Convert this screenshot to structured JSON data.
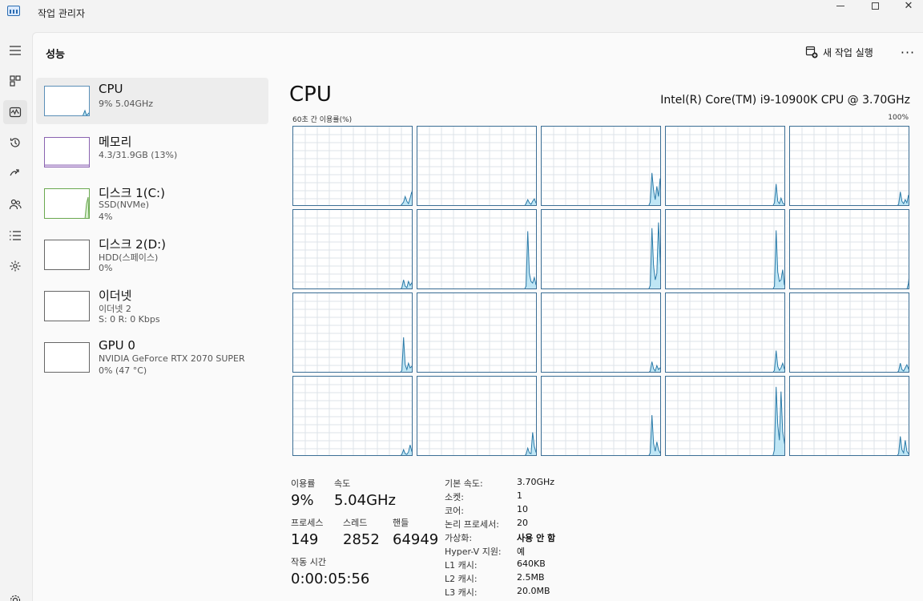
{
  "window": {
    "title": "작업 관리자",
    "min_icon": "minimize-icon",
    "max_icon": "maximize-icon",
    "close_glyph": "✕"
  },
  "nav": [
    {
      "icon": "hamburger-icon",
      "active": false
    },
    {
      "icon": "processes-icon",
      "active": false
    },
    {
      "icon": "performance-icon",
      "active": true
    },
    {
      "icon": "app-history-icon",
      "active": false
    },
    {
      "icon": "startup-apps-icon",
      "active": false
    },
    {
      "icon": "users-icon",
      "active": false
    },
    {
      "icon": "details-icon",
      "active": false
    },
    {
      "icon": "services-icon",
      "active": false
    },
    {
      "icon": "settings-icon",
      "active": false
    }
  ],
  "header": {
    "title": "성능",
    "run_task": "새 작업 실행",
    "more": "···"
  },
  "sidebar": [
    {
      "name": "CPU",
      "lines": [
        "9% 5.04GHz"
      ]
    },
    {
      "name": "메모리",
      "lines": [
        "4.3/31.9GB (13%)"
      ]
    },
    {
      "name": "디스크 1(C:)",
      "lines": [
        "SSD(NVMe)",
        "4%"
      ]
    },
    {
      "name": "디스크 2(D:)",
      "lines": [
        "HDD(스페이스)",
        "0%"
      ]
    },
    {
      "name": "이더넷",
      "lines": [
        "이더넷 2",
        "S: 0 R: 0 Kbps"
      ]
    },
    {
      "name": "GPU 0",
      "lines": [
        "NVIDIA GeForce RTX 2070 SUPER",
        "0% (47 °C)"
      ]
    }
  ],
  "cpu": {
    "title": "CPU",
    "model": "Intel(R) Core(TM) i9-10900K CPU @ 3.70GHz",
    "graph_label": "60초 간 이용률(%)",
    "graph_max": "100%",
    "colors": {
      "line": "#2a7aa8",
      "fill": "#bfe6f5",
      "grid": "#dde3e8",
      "border": "#3b6e95"
    },
    "cores": [
      [
        0,
        0,
        0,
        0,
        0,
        0,
        0,
        0,
        0,
        0,
        0,
        0,
        0,
        0,
        0,
        0,
        0,
        0,
        0,
        0,
        0,
        0,
        0,
        0,
        0,
        0,
        0,
        0,
        0,
        0,
        0,
        0,
        0,
        0,
        0,
        0,
        0,
        0,
        0,
        0,
        0,
        0,
        0,
        0,
        0,
        0,
        0,
        0,
        0,
        0,
        0,
        0,
        0,
        0,
        0,
        0,
        0,
        0,
        0,
        0,
        0,
        0,
        0,
        0,
        0,
        0,
        2,
        5,
        12,
        6,
        3,
        10,
        18,
        8
      ],
      [
        0,
        0,
        0,
        0,
        0,
        0,
        0,
        0,
        0,
        0,
        0,
        0,
        0,
        0,
        0,
        0,
        0,
        0,
        0,
        0,
        0,
        0,
        0,
        0,
        0,
        0,
        0,
        0,
        0,
        0,
        0,
        0,
        0,
        0,
        0,
        0,
        0,
        0,
        0,
        0,
        0,
        0,
        0,
        0,
        0,
        0,
        0,
        0,
        0,
        0,
        0,
        0,
        0,
        0,
        0,
        0,
        0,
        0,
        0,
        0,
        0,
        0,
        0,
        0,
        0,
        0,
        3,
        8,
        4,
        2,
        6,
        9,
        4,
        2
      ],
      [
        0,
        0,
        0,
        0,
        0,
        0,
        0,
        0,
        0,
        0,
        0,
        0,
        0,
        0,
        0,
        0,
        0,
        0,
        0,
        0,
        0,
        0,
        0,
        0,
        0,
        0,
        0,
        0,
        0,
        0,
        0,
        0,
        0,
        0,
        0,
        0,
        0,
        0,
        0,
        0,
        0,
        0,
        0,
        0,
        0,
        0,
        0,
        0,
        0,
        0,
        0,
        0,
        0,
        0,
        0,
        0,
        0,
        0,
        0,
        0,
        0,
        0,
        0,
        0,
        0,
        0,
        5,
        42,
        20,
        8,
        25,
        12,
        35,
        6
      ],
      [
        0,
        0,
        0,
        0,
        0,
        0,
        0,
        0,
        0,
        0,
        0,
        0,
        0,
        0,
        0,
        0,
        0,
        0,
        0,
        0,
        0,
        0,
        0,
        0,
        0,
        0,
        0,
        0,
        0,
        0,
        0,
        0,
        0,
        0,
        0,
        0,
        0,
        0,
        0,
        0,
        0,
        0,
        0,
        0,
        0,
        0,
        0,
        0,
        0,
        0,
        0,
        0,
        0,
        0,
        0,
        0,
        0,
        0,
        0,
        0,
        0,
        0,
        0,
        0,
        0,
        0,
        4,
        28,
        6,
        3,
        10,
        4,
        2,
        1
      ],
      [
        0,
        0,
        0,
        0,
        0,
        0,
        0,
        0,
        0,
        0,
        0,
        0,
        0,
        0,
        0,
        0,
        0,
        0,
        0,
        0,
        0,
        0,
        0,
        0,
        0,
        0,
        0,
        0,
        0,
        0,
        0,
        0,
        0,
        0,
        0,
        0,
        0,
        0,
        0,
        0,
        0,
        0,
        0,
        0,
        0,
        0,
        0,
        0,
        0,
        0,
        0,
        0,
        0,
        0,
        0,
        0,
        0,
        0,
        0,
        0,
        0,
        0,
        0,
        0,
        0,
        0,
        2,
        18,
        6,
        3,
        8,
        4,
        14,
        5
      ],
      [
        0,
        0,
        0,
        0,
        0,
        0,
        0,
        0,
        0,
        0,
        0,
        0,
        0,
        0,
        0,
        0,
        0,
        0,
        0,
        0,
        0,
        0,
        0,
        0,
        0,
        0,
        0,
        0,
        0,
        0,
        0,
        0,
        0,
        0,
        0,
        0,
        0,
        0,
        0,
        0,
        0,
        0,
        0,
        0,
        0,
        0,
        0,
        0,
        0,
        0,
        0,
        0,
        0,
        0,
        0,
        0,
        0,
        0,
        0,
        0,
        0,
        0,
        0,
        0,
        0,
        0,
        2,
        12,
        4,
        2,
        10,
        5,
        8,
        3
      ],
      [
        0,
        0,
        0,
        0,
        0,
        0,
        0,
        0,
        0,
        0,
        0,
        0,
        0,
        0,
        0,
        0,
        0,
        0,
        0,
        0,
        0,
        0,
        0,
        0,
        0,
        0,
        0,
        0,
        0,
        0,
        0,
        0,
        0,
        0,
        0,
        0,
        0,
        0,
        0,
        0,
        0,
        0,
        0,
        0,
        0,
        0,
        0,
        0,
        0,
        0,
        0,
        0,
        0,
        0,
        0,
        0,
        0,
        0,
        0,
        0,
        0,
        0,
        0,
        0,
        0,
        0,
        4,
        74,
        20,
        10,
        8,
        15,
        6,
        3
      ],
      [
        0,
        0,
        0,
        0,
        0,
        0,
        0,
        0,
        0,
        0,
        0,
        0,
        0,
        0,
        0,
        0,
        0,
        0,
        0,
        0,
        0,
        0,
        0,
        0,
        0,
        0,
        0,
        0,
        0,
        0,
        0,
        0,
        0,
        0,
        0,
        0,
        0,
        0,
        0,
        0,
        0,
        0,
        0,
        0,
        0,
        0,
        0,
        0,
        0,
        0,
        0,
        0,
        0,
        0,
        0,
        0,
        0,
        0,
        0,
        0,
        0,
        0,
        0,
        0,
        0,
        0,
        5,
        78,
        30,
        12,
        20,
        85,
        40,
        10
      ],
      [
        0,
        0,
        0,
        0,
        0,
        0,
        0,
        0,
        0,
        0,
        0,
        0,
        0,
        0,
        0,
        0,
        0,
        0,
        0,
        0,
        0,
        0,
        0,
        0,
        0,
        0,
        0,
        0,
        0,
        0,
        0,
        0,
        0,
        0,
        0,
        0,
        0,
        0,
        0,
        0,
        0,
        0,
        0,
        0,
        0,
        0,
        0,
        0,
        0,
        0,
        0,
        0,
        0,
        0,
        0,
        0,
        0,
        0,
        0,
        0,
        0,
        0,
        0,
        0,
        0,
        0,
        4,
        75,
        22,
        10,
        12,
        25,
        6,
        3
      ],
      [
        0,
        0,
        0,
        0,
        0,
        0,
        0,
        0,
        0,
        0,
        0,
        0,
        0,
        0,
        0,
        0,
        0,
        0,
        0,
        0,
        0,
        0,
        0,
        0,
        0,
        0,
        0,
        0,
        0,
        0,
        0,
        0,
        0,
        0,
        0,
        0,
        0,
        0,
        0,
        0,
        0,
        0,
        0,
        0,
        0,
        0,
        0,
        0,
        0,
        0,
        0,
        0,
        0,
        0,
        0,
        0,
        0,
        0,
        0,
        0,
        0,
        0,
        0,
        0,
        0,
        0,
        0,
        0,
        0,
        0,
        0,
        0,
        8,
        30
      ],
      [
        0,
        0,
        0,
        0,
        0,
        0,
        0,
        0,
        0,
        0,
        0,
        0,
        0,
        0,
        0,
        0,
        0,
        0,
        0,
        0,
        0,
        0,
        0,
        0,
        0,
        0,
        0,
        0,
        0,
        0,
        0,
        0,
        0,
        0,
        0,
        0,
        0,
        0,
        0,
        0,
        0,
        0,
        0,
        0,
        0,
        0,
        0,
        0,
        0,
        0,
        0,
        0,
        0,
        0,
        0,
        0,
        0,
        0,
        0,
        0,
        0,
        0,
        0,
        0,
        0,
        0,
        3,
        45,
        10,
        4,
        12,
        6,
        8,
        3
      ],
      [
        0,
        0,
        0,
        0,
        0,
        0,
        0,
        0,
        0,
        0,
        0,
        0,
        0,
        0,
        0,
        0,
        0,
        0,
        0,
        0,
        0,
        0,
        0,
        0,
        0,
        0,
        0,
        0,
        0,
        0,
        0,
        0,
        0,
        0,
        0,
        0,
        0,
        0,
        0,
        0,
        0,
        0,
        0,
        0,
        0,
        0,
        0,
        0,
        0,
        0,
        0,
        0,
        0,
        0,
        0,
        0,
        0,
        0,
        0,
        0,
        0,
        0,
        0,
        0,
        0,
        0,
        0,
        0,
        0,
        0,
        0,
        0,
        0,
        0
      ],
      [
        0,
        0,
        0,
        0,
        0,
        0,
        0,
        0,
        0,
        0,
        0,
        0,
        0,
        0,
        0,
        0,
        0,
        0,
        0,
        0,
        0,
        0,
        0,
        0,
        0,
        0,
        0,
        0,
        0,
        0,
        0,
        0,
        0,
        0,
        0,
        0,
        0,
        0,
        0,
        0,
        0,
        0,
        0,
        0,
        0,
        0,
        0,
        0,
        0,
        0,
        0,
        0,
        0,
        0,
        0,
        0,
        0,
        0,
        0,
        0,
        0,
        0,
        0,
        0,
        0,
        0,
        2,
        14,
        5,
        2,
        9,
        4,
        6,
        2
      ],
      [
        0,
        0,
        0,
        0,
        0,
        0,
        0,
        0,
        0,
        0,
        0,
        0,
        0,
        0,
        0,
        0,
        0,
        0,
        0,
        0,
        0,
        0,
        0,
        0,
        0,
        0,
        0,
        0,
        0,
        0,
        0,
        0,
        0,
        0,
        0,
        0,
        0,
        0,
        0,
        0,
        0,
        0,
        0,
        0,
        0,
        0,
        0,
        0,
        0,
        0,
        0,
        0,
        0,
        0,
        0,
        0,
        0,
        0,
        0,
        0,
        0,
        0,
        0,
        0,
        0,
        0,
        3,
        28,
        8,
        3,
        6,
        12,
        5,
        2
      ],
      [
        0,
        0,
        0,
        0,
        0,
        0,
        0,
        0,
        0,
        0,
        0,
        0,
        0,
        0,
        0,
        0,
        0,
        0,
        0,
        0,
        0,
        0,
        0,
        0,
        0,
        0,
        0,
        0,
        0,
        0,
        0,
        0,
        0,
        0,
        0,
        0,
        0,
        0,
        0,
        0,
        0,
        0,
        0,
        0,
        0,
        0,
        0,
        0,
        0,
        0,
        0,
        0,
        0,
        0,
        0,
        0,
        0,
        0,
        0,
        0,
        0,
        0,
        0,
        0,
        0,
        0,
        2,
        12,
        4,
        2,
        6,
        10,
        5,
        2
      ],
      [
        0,
        0,
        0,
        0,
        0,
        0,
        0,
        0,
        0,
        0,
        0,
        0,
        0,
        0,
        0,
        0,
        0,
        0,
        0,
        0,
        0,
        0,
        0,
        0,
        0,
        0,
        0,
        0,
        0,
        0,
        0,
        0,
        0,
        0,
        0,
        0,
        0,
        0,
        0,
        0,
        0,
        0,
        0,
        0,
        0,
        0,
        0,
        0,
        0,
        0,
        0,
        0,
        0,
        0,
        0,
        0,
        0,
        0,
        0,
        0,
        0,
        0,
        0,
        0,
        0,
        0,
        2,
        8,
        3,
        2,
        5,
        14,
        6,
        3
      ],
      [
        0,
        0,
        0,
        0,
        0,
        0,
        0,
        0,
        0,
        0,
        0,
        0,
        0,
        0,
        0,
        0,
        0,
        0,
        0,
        0,
        0,
        0,
        0,
        0,
        0,
        0,
        0,
        0,
        0,
        0,
        0,
        0,
        0,
        0,
        0,
        0,
        0,
        0,
        0,
        0,
        0,
        0,
        0,
        0,
        0,
        0,
        0,
        0,
        0,
        0,
        0,
        0,
        0,
        0,
        0,
        0,
        0,
        0,
        0,
        0,
        0,
        0,
        0,
        0,
        0,
        0,
        2,
        10,
        4,
        3,
        30,
        12,
        5,
        2
      ],
      [
        0,
        0,
        0,
        0,
        0,
        0,
        0,
        0,
        0,
        0,
        0,
        0,
        0,
        0,
        0,
        0,
        0,
        0,
        0,
        0,
        0,
        0,
        0,
        0,
        0,
        0,
        0,
        0,
        0,
        0,
        0,
        0,
        0,
        0,
        0,
        0,
        0,
        0,
        0,
        0,
        0,
        0,
        0,
        0,
        0,
        0,
        0,
        0,
        0,
        0,
        0,
        0,
        0,
        0,
        0,
        0,
        0,
        0,
        0,
        0,
        0,
        0,
        0,
        0,
        0,
        0,
        4,
        52,
        16,
        6,
        18,
        8,
        4,
        2
      ],
      [
        0,
        0,
        0,
        0,
        0,
        0,
        0,
        0,
        0,
        0,
        0,
        0,
        0,
        0,
        0,
        0,
        0,
        0,
        0,
        0,
        0,
        0,
        0,
        0,
        0,
        0,
        0,
        0,
        0,
        0,
        0,
        0,
        0,
        0,
        0,
        0,
        0,
        0,
        0,
        0,
        0,
        0,
        0,
        0,
        0,
        0,
        0,
        0,
        0,
        0,
        0,
        0,
        0,
        0,
        0,
        0,
        0,
        0,
        0,
        0,
        0,
        0,
        0,
        0,
        0,
        0,
        8,
        88,
        40,
        20,
        82,
        30,
        18,
        6
      ],
      [
        0,
        0,
        0,
        0,
        0,
        0,
        0,
        0,
        0,
        0,
        0,
        0,
        0,
        0,
        0,
        0,
        0,
        0,
        0,
        0,
        0,
        0,
        0,
        0,
        0,
        0,
        0,
        0,
        0,
        0,
        0,
        0,
        0,
        0,
        0,
        0,
        0,
        0,
        0,
        0,
        0,
        0,
        0,
        0,
        0,
        0,
        0,
        0,
        0,
        0,
        0,
        0,
        0,
        0,
        0,
        0,
        0,
        0,
        0,
        0,
        0,
        0,
        0,
        0,
        0,
        0,
        3,
        25,
        8,
        4,
        20,
        6,
        3,
        1
      ]
    ]
  },
  "stats": {
    "util_label": "이용률",
    "util_value": "9%",
    "speed_label": "속도",
    "speed_value": "5.04GHz",
    "proc_label": "프로세스",
    "proc_value": "149",
    "thread_label": "스레드",
    "thread_value": "2852",
    "handle_label": "핸들",
    "handle_value": "64949",
    "uptime_label": "작동 시간",
    "uptime_value": "0:00:05:56"
  },
  "specs": [
    {
      "label": "기본 속도:",
      "value": "3.70GHz"
    },
    {
      "label": "소켓:",
      "value": "1"
    },
    {
      "label": "코어:",
      "value": "10"
    },
    {
      "label": "논리 프로세서:",
      "value": "20"
    },
    {
      "label": "가상화:",
      "value": "사용 안 함"
    },
    {
      "label": "Hyper-V 지원:",
      "value": "예"
    },
    {
      "label": "L1 캐시:",
      "value": "640KB"
    },
    {
      "label": "L2 캐시:",
      "value": "2.5MB"
    },
    {
      "label": "L3 캐시:",
      "value": "20.0MB"
    }
  ]
}
